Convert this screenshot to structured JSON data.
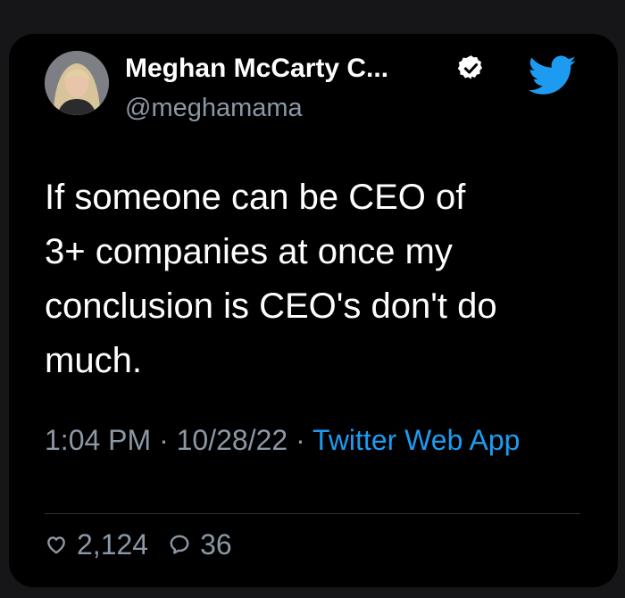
{
  "tweet": {
    "author": {
      "display_name": "Meghan McCarty C...",
      "handle": "@meghamama"
    },
    "text": "If someone can be CEO of\n3+ companies at once my\nconclusion is CEO's don't do\nmuch.",
    "meta": {
      "time": "1:04 PM",
      "separator": " · ",
      "date": "10/28/22",
      "app": "Twitter Web App"
    },
    "stats": {
      "likes": "2,124",
      "replies": "36"
    }
  },
  "colors": {
    "background": "#000000",
    "text": "#ffffff",
    "secondary": "#8b98a5",
    "accent": "#1d9bf0"
  },
  "icons": {
    "verified": "verified-badge-icon",
    "brand": "twitter-bird-icon",
    "like": "heart-icon",
    "reply": "reply-bubble-icon"
  }
}
